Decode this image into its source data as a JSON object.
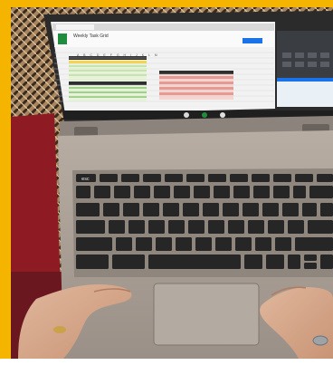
{
  "scene": {
    "subject": "hands typing on a laptop",
    "screen": {
      "browser_tab": "Weekly Task Grid",
      "app": "Sheets",
      "sheet_title": "Weekly Task Grid",
      "column_letters": "A B C D E F G H I J K L M"
    },
    "keyboard": {
      "row1": [
        "esc",
        "←",
        "→",
        "C",
        "▭",
        "◫",
        "☼",
        "☀",
        "◄",
        "◄)",
        "◄))",
        "🔒"
      ],
      "row2": [
        "~",
        "1",
        "2",
        "3",
        "4",
        "5",
        "6",
        "7",
        "8",
        "9",
        "0",
        "-",
        "=",
        "backspace"
      ],
      "row3": [
        "tab",
        "q",
        "w",
        "e",
        "r",
        "t",
        "y",
        "u",
        "i",
        "o",
        "p",
        "[",
        "]",
        "\\"
      ],
      "row4": [
        "",
        "a",
        "s",
        "d",
        "f",
        "g",
        "h",
        "j",
        "k",
        "l",
        ";",
        "'",
        "enter"
      ],
      "row5": [
        "shift",
        "z",
        "x",
        "c",
        "v",
        "b",
        "n",
        "m",
        "<",
        ">",
        "?",
        "shift"
      ],
      "row6": [
        "ctrl",
        "alt",
        "",
        "alt",
        "ctrl",
        "◄",
        "▲",
        "▼",
        "►"
      ]
    },
    "colors": {
      "accent": "#f4b400",
      "laptop_body": "#a99f95",
      "keys": "#2a2a2a",
      "cushion": "#8e1b24"
    }
  }
}
